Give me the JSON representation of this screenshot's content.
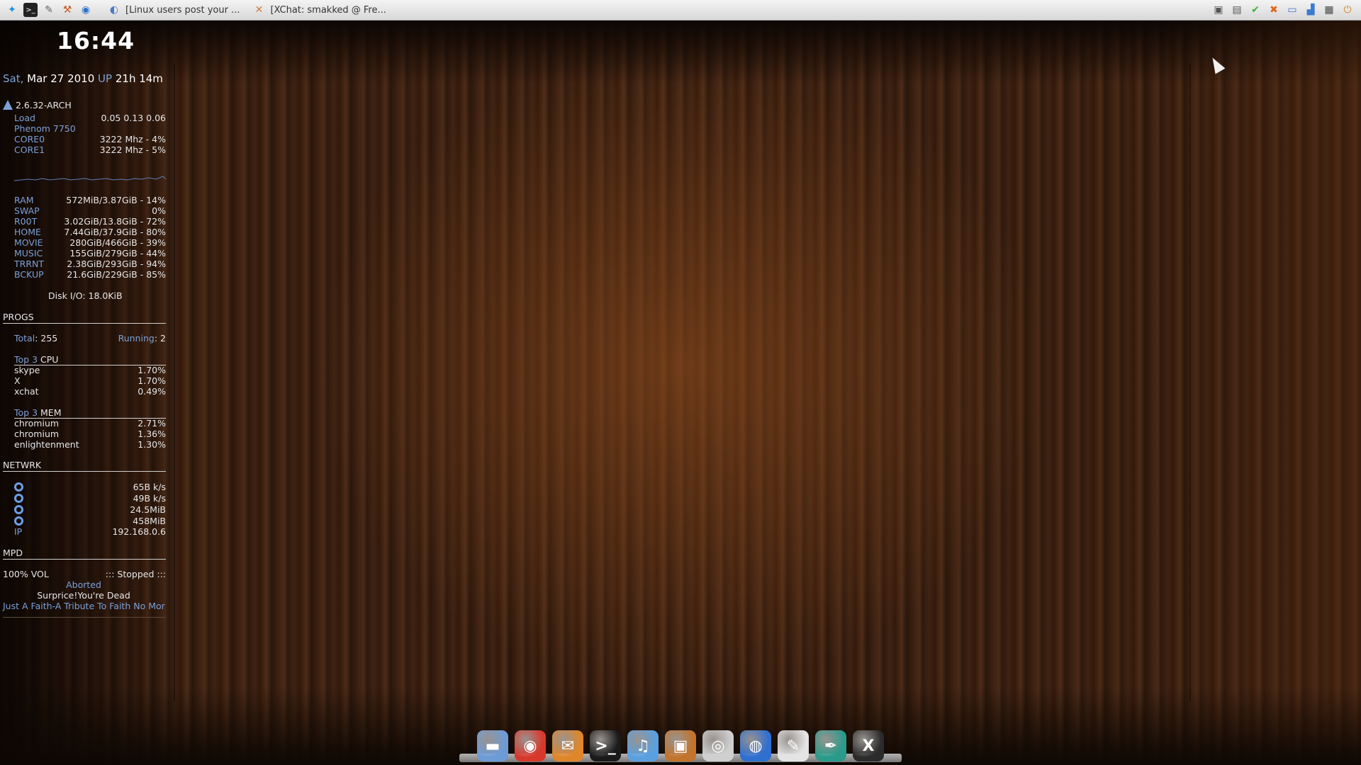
{
  "panel": {
    "launchers": [
      "arch-icon",
      "terminal-icon",
      "text-editor-icon",
      "paint-icon",
      "browser-icon"
    ],
    "tasks": [
      {
        "label": "[Linux users post your ..."
      },
      {
        "label": "[XChat: smakked @ Fre..."
      }
    ],
    "tray": [
      "screenshot-icon",
      "clipboard-icon",
      "checkmark-icon",
      "xchat-icon",
      "display-icon",
      "network-icon",
      "grid-icon",
      "power-icon"
    ]
  },
  "conky": {
    "clock": "16:44",
    "date": {
      "day": "Sat,",
      "date": "Mar 27 2010",
      "up_label": "UP",
      "uptime": "21h 14m"
    },
    "system": {
      "kernel": "2.6.32-ARCH",
      "load_label": "Load",
      "load": "0.05 0.13 0.06",
      "cpu_name": "Phenom 7750",
      "cores": [
        {
          "label": "CORE0",
          "value": "3222 Mhz -  4%"
        },
        {
          "label": "CORE1",
          "value": "3222 Mhz -  5%"
        }
      ]
    },
    "storage": [
      {
        "label": "RAM",
        "value": "572MiB/3.87GiB - 14%"
      },
      {
        "label": "SWAP",
        "value": "0%"
      },
      {
        "label": "R00T",
        "value": "3.02GiB/13.8GiB - 72%"
      },
      {
        "label": "HOME",
        "value": "7.44GiB/37.9GiB - 80%"
      },
      {
        "label": "MOVIE",
        "value": "280GiB/466GiB - 39%"
      },
      {
        "label": "MUSIC",
        "value": "155GiB/279GiB - 44%"
      },
      {
        "label": "TRRNT",
        "value": "2.38GiB/293GiB - 94%"
      },
      {
        "label": "BCKUP",
        "value": "21.6GiB/229GiB - 85%"
      }
    ],
    "disk_io": "Disk I/O: 18.0KiB",
    "progs": {
      "heading": "PROGS",
      "total_label": "Total",
      "total": ": 255",
      "running_label": "Running",
      "running": ": 2",
      "top_cpu_label": "Top 3",
      "top_cpu_suffix": "CPU",
      "top_cpu": [
        {
          "name": "skype",
          "value": "1.70%"
        },
        {
          "name": "X",
          "value": "1.70%"
        },
        {
          "name": "xchat",
          "value": "0.49%"
        }
      ],
      "top_mem_label": "Top 3",
      "top_mem_suffix": "MEM",
      "top_mem": [
        {
          "name": "chromium",
          "value": "2.71%"
        },
        {
          "name": "chromium",
          "value": "1.36%"
        },
        {
          "name": "enlightenment",
          "value": "1.30%"
        }
      ]
    },
    "network": {
      "heading": "NETWRK",
      "values": [
        "65B  k/s",
        "49B  k/s",
        "24.5MiB",
        "458MiB"
      ],
      "ip_label": "IP",
      "ip": "192.168.0.6"
    },
    "mpd": {
      "heading": "MPD",
      "volume": "100% VOL",
      "state": "::: Stopped :::",
      "artist": "Aborted",
      "title": "Surprice!You're Dead",
      "album": "Just A Faith-A Tribute To Faith No Mor"
    }
  },
  "dock": [
    {
      "name": "folder-icon",
      "color": "#6d9bd6",
      "glyph": "▬"
    },
    {
      "name": "chrome-icon",
      "color": "#d8382c",
      "glyph": "◉"
    },
    {
      "name": "thunderbird-icon",
      "color": "#e0862a",
      "glyph": "✉"
    },
    {
      "name": "terminal-icon",
      "color": "#1a1a1a",
      "glyph": ">_"
    },
    {
      "name": "music-icon",
      "color": "#5aa0e0",
      "glyph": "♫"
    },
    {
      "name": "photos-icon",
      "color": "#c2732c",
      "glyph": "▣"
    },
    {
      "name": "webcam-icon",
      "color": "#cfcfcf",
      "glyph": "◎"
    },
    {
      "name": "globe-icon",
      "color": "#2f6fd0",
      "glyph": "◍"
    },
    {
      "name": "mail-icon",
      "color": "#e4e4e4",
      "glyph": "✎"
    },
    {
      "name": "feather-icon",
      "color": "#2a9a8a",
      "glyph": "✒"
    },
    {
      "name": "xchat-icon",
      "color": "#2b2b2b",
      "glyph": "X"
    }
  ]
}
